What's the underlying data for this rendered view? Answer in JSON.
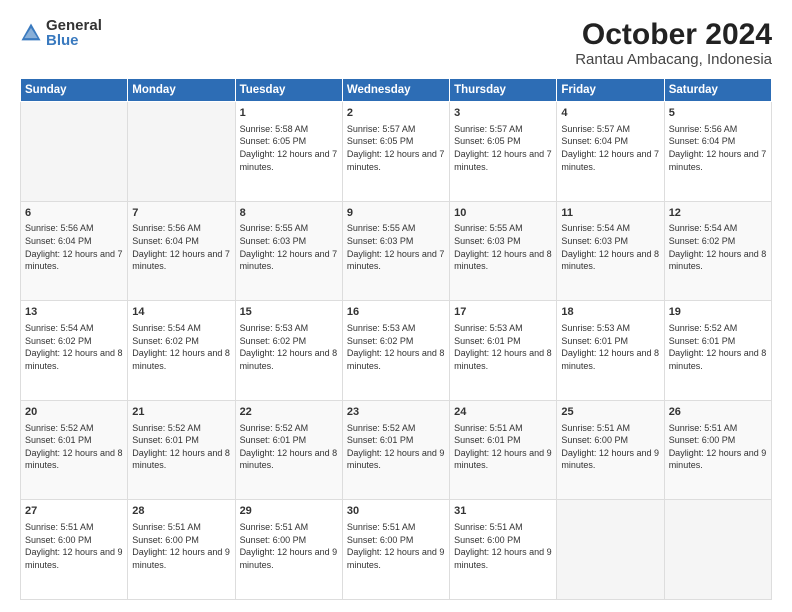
{
  "logo": {
    "general": "General",
    "blue": "Blue"
  },
  "title": "October 2024",
  "subtitle": "Rantau Ambacang, Indonesia",
  "days_of_week": [
    "Sunday",
    "Monday",
    "Tuesday",
    "Wednesday",
    "Thursday",
    "Friday",
    "Saturday"
  ],
  "weeks": [
    [
      {
        "day": "",
        "info": ""
      },
      {
        "day": "",
        "info": ""
      },
      {
        "day": "1",
        "info": "Sunrise: 5:58 AM\nSunset: 6:05 PM\nDaylight: 12 hours\nand 7 minutes."
      },
      {
        "day": "2",
        "info": "Sunrise: 5:57 AM\nSunset: 6:05 PM\nDaylight: 12 hours\nand 7 minutes."
      },
      {
        "day": "3",
        "info": "Sunrise: 5:57 AM\nSunset: 6:05 PM\nDaylight: 12 hours\nand 7 minutes."
      },
      {
        "day": "4",
        "info": "Sunrise: 5:57 AM\nSunset: 6:04 PM\nDaylight: 12 hours\nand 7 minutes."
      },
      {
        "day": "5",
        "info": "Sunrise: 5:56 AM\nSunset: 6:04 PM\nDaylight: 12 hours\nand 7 minutes."
      }
    ],
    [
      {
        "day": "6",
        "info": "Sunrise: 5:56 AM\nSunset: 6:04 PM\nDaylight: 12 hours\nand 7 minutes."
      },
      {
        "day": "7",
        "info": "Sunrise: 5:56 AM\nSunset: 6:04 PM\nDaylight: 12 hours\nand 7 minutes."
      },
      {
        "day": "8",
        "info": "Sunrise: 5:55 AM\nSunset: 6:03 PM\nDaylight: 12 hours\nand 7 minutes."
      },
      {
        "day": "9",
        "info": "Sunrise: 5:55 AM\nSunset: 6:03 PM\nDaylight: 12 hours\nand 7 minutes."
      },
      {
        "day": "10",
        "info": "Sunrise: 5:55 AM\nSunset: 6:03 PM\nDaylight: 12 hours\nand 8 minutes."
      },
      {
        "day": "11",
        "info": "Sunrise: 5:54 AM\nSunset: 6:03 PM\nDaylight: 12 hours\nand 8 minutes."
      },
      {
        "day": "12",
        "info": "Sunrise: 5:54 AM\nSunset: 6:02 PM\nDaylight: 12 hours\nand 8 minutes."
      }
    ],
    [
      {
        "day": "13",
        "info": "Sunrise: 5:54 AM\nSunset: 6:02 PM\nDaylight: 12 hours\nand 8 minutes."
      },
      {
        "day": "14",
        "info": "Sunrise: 5:54 AM\nSunset: 6:02 PM\nDaylight: 12 hours\nand 8 minutes."
      },
      {
        "day": "15",
        "info": "Sunrise: 5:53 AM\nSunset: 6:02 PM\nDaylight: 12 hours\nand 8 minutes."
      },
      {
        "day": "16",
        "info": "Sunrise: 5:53 AM\nSunset: 6:02 PM\nDaylight: 12 hours\nand 8 minutes."
      },
      {
        "day": "17",
        "info": "Sunrise: 5:53 AM\nSunset: 6:01 PM\nDaylight: 12 hours\nand 8 minutes."
      },
      {
        "day": "18",
        "info": "Sunrise: 5:53 AM\nSunset: 6:01 PM\nDaylight: 12 hours\nand 8 minutes."
      },
      {
        "day": "19",
        "info": "Sunrise: 5:52 AM\nSunset: 6:01 PM\nDaylight: 12 hours\nand 8 minutes."
      }
    ],
    [
      {
        "day": "20",
        "info": "Sunrise: 5:52 AM\nSunset: 6:01 PM\nDaylight: 12 hours\nand 8 minutes."
      },
      {
        "day": "21",
        "info": "Sunrise: 5:52 AM\nSunset: 6:01 PM\nDaylight: 12 hours\nand 8 minutes."
      },
      {
        "day": "22",
        "info": "Sunrise: 5:52 AM\nSunset: 6:01 PM\nDaylight: 12 hours\nand 8 minutes."
      },
      {
        "day": "23",
        "info": "Sunrise: 5:52 AM\nSunset: 6:01 PM\nDaylight: 12 hours\nand 9 minutes."
      },
      {
        "day": "24",
        "info": "Sunrise: 5:51 AM\nSunset: 6:01 PM\nDaylight: 12 hours\nand 9 minutes."
      },
      {
        "day": "25",
        "info": "Sunrise: 5:51 AM\nSunset: 6:00 PM\nDaylight: 12 hours\nand 9 minutes."
      },
      {
        "day": "26",
        "info": "Sunrise: 5:51 AM\nSunset: 6:00 PM\nDaylight: 12 hours\nand 9 minutes."
      }
    ],
    [
      {
        "day": "27",
        "info": "Sunrise: 5:51 AM\nSunset: 6:00 PM\nDaylight: 12 hours\nand 9 minutes."
      },
      {
        "day": "28",
        "info": "Sunrise: 5:51 AM\nSunset: 6:00 PM\nDaylight: 12 hours\nand 9 minutes."
      },
      {
        "day": "29",
        "info": "Sunrise: 5:51 AM\nSunset: 6:00 PM\nDaylight: 12 hours\nand 9 minutes."
      },
      {
        "day": "30",
        "info": "Sunrise: 5:51 AM\nSunset: 6:00 PM\nDaylight: 12 hours\nand 9 minutes."
      },
      {
        "day": "31",
        "info": "Sunrise: 5:51 AM\nSunset: 6:00 PM\nDaylight: 12 hours\nand 9 minutes."
      },
      {
        "day": "",
        "info": ""
      },
      {
        "day": "",
        "info": ""
      }
    ]
  ]
}
